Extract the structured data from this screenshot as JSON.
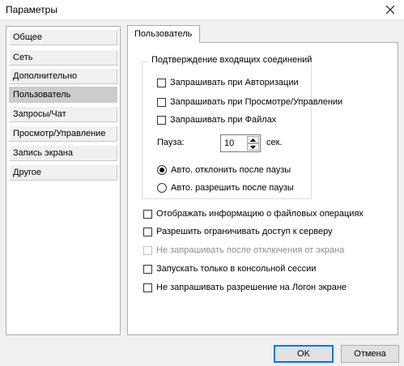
{
  "window": {
    "title": "Параметры"
  },
  "sidebar": {
    "items": [
      {
        "label": "Общее",
        "selected": false
      },
      {
        "label": "Сеть",
        "selected": false
      },
      {
        "label": "Дополнительно",
        "selected": false
      },
      {
        "label": "Пользователь",
        "selected": true
      },
      {
        "label": "Запросы/Чат",
        "selected": false
      },
      {
        "label": "Просмотр/Управление",
        "selected": false
      },
      {
        "label": "Запись экрана",
        "selected": false
      },
      {
        "label": "Другое",
        "selected": false
      }
    ]
  },
  "tab": {
    "label": "Пользователь"
  },
  "confirm_group": {
    "title": "Подтверждение входящих соединений",
    "checkboxes": [
      {
        "label": "Запрашивать при Авторизации",
        "checked": false
      },
      {
        "label": "Запрашивать при Просмотре/Управлении",
        "checked": false
      },
      {
        "label": "Запрашивать при Файлах",
        "checked": false
      }
    ],
    "pause_label": "Пауза:",
    "pause_value": "10",
    "pause_unit": "сек.",
    "radios": [
      {
        "label": "Авто. отклонить после паузы",
        "checked": true
      },
      {
        "label": "Авто. разрешить после паузы",
        "checked": false
      }
    ]
  },
  "options": [
    {
      "label": "Отображать информацию о файловых операциях",
      "checked": false,
      "disabled": false
    },
    {
      "label": "Разрешить ограничивать доступ к серверу",
      "checked": false,
      "disabled": false
    },
    {
      "label": "Не запрашивать после отключения от экрана",
      "checked": false,
      "disabled": true
    },
    {
      "label": "Запускать только в консольной сессии",
      "checked": false,
      "disabled": false
    },
    {
      "label": "Не запрашивать разрешение на Логон экране",
      "checked": false,
      "disabled": false
    }
  ],
  "buttons": {
    "ok": "OK",
    "cancel": "Отмена"
  },
  "colors": {
    "accent": "#0078d7",
    "selected_item": "#cccccc",
    "panel_bg": "#ffffff",
    "window_bg": "#f0f0f0"
  }
}
